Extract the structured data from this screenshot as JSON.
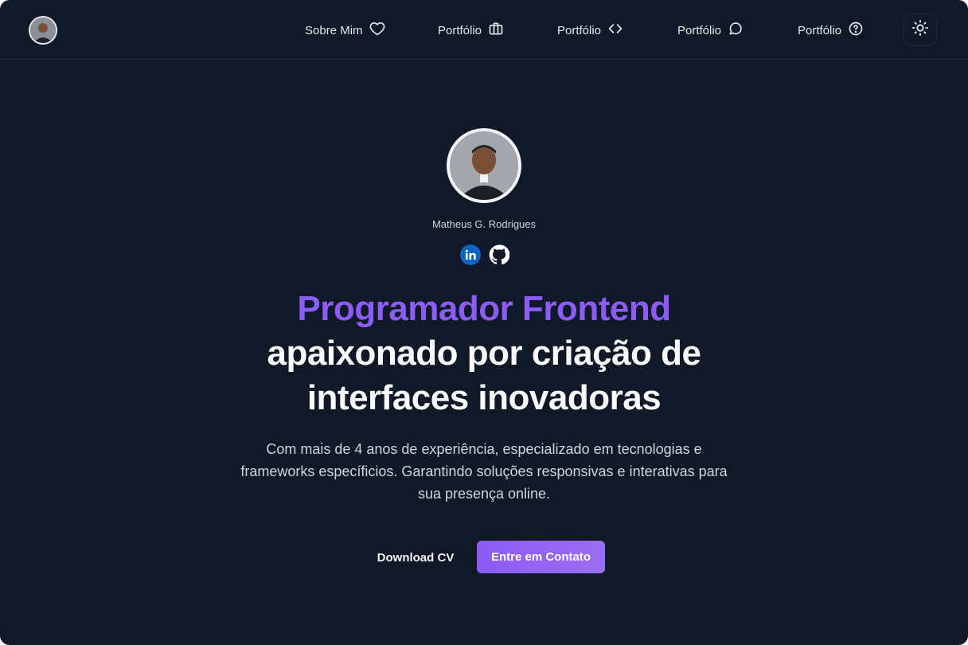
{
  "nav": {
    "items": [
      {
        "label": "Sobre Mim",
        "icon": "heart-icon"
      },
      {
        "label": "Portfólio",
        "icon": "briefcase-icon"
      },
      {
        "label": "Portfólio",
        "icon": "code-icon"
      },
      {
        "label": "Portfólio",
        "icon": "chat-bubble-icon"
      },
      {
        "label": "Portfólio",
        "icon": "help-circle-icon"
      }
    ],
    "theme_toggle_icon": "sun-icon"
  },
  "hero": {
    "name": "Matheus G. Rodrigues",
    "socials": [
      {
        "icon": "linkedin-icon",
        "color": "#0a66c2"
      },
      {
        "icon": "github-icon",
        "color": "#ffffff"
      }
    ],
    "headline_accent": "Programador Frontend",
    "headline_line1": "apaixonado por criação de",
    "headline_line2": "interfaces inovadoras",
    "description": "Com mais de 4 anos de experiência, especializado em tecnologias e frameworks específicios. Garantindo soluções responsivas e interativas para sua presença online.",
    "download_label": "Download CV",
    "contact_label": "Entre em Contato"
  },
  "colors": {
    "background": "#111827",
    "accent": "#8b5cf6",
    "text": "#f9fafb"
  }
}
